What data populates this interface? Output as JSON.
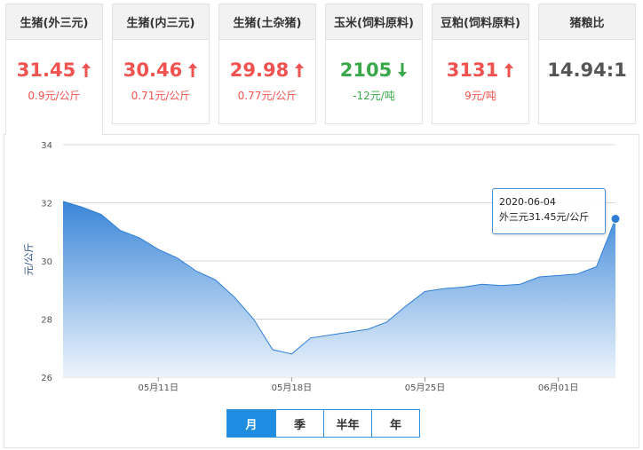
{
  "cards": [
    {
      "title": "生猪(外三元)",
      "price": "31.45",
      "change": "0.9元/公斤",
      "trend": "up"
    },
    {
      "title": "生猪(内三元)",
      "price": "30.46",
      "change": "0.71元/公斤",
      "trend": "up"
    },
    {
      "title": "生猪(土杂猪)",
      "price": "29.98",
      "change": "0.77元/公斤",
      "trend": "up"
    },
    {
      "title": "玉米(饲料原料)",
      "price": "2105",
      "change": "-12元/吨",
      "trend": "down"
    },
    {
      "title": "豆粕(饲料原料)",
      "price": "3131",
      "change": "9元/吨",
      "trend": "up"
    },
    {
      "title": "猪粮比",
      "price": "14.94:1",
      "change": "",
      "trend": "flat"
    }
  ],
  "colors": {
    "up": "#f0524f",
    "down": "#3aa84a",
    "accent": "#1e8ce0",
    "area_top": "#2f7fd6",
    "area_bottom": "#eaf3fc"
  },
  "icons": {
    "up": "arrow-up-icon",
    "down": "arrow-down-icon"
  },
  "chart_data": {
    "type": "area",
    "ylabel": "元/公斤",
    "ylim": [
      26,
      34
    ],
    "yticks": [
      26,
      28,
      30,
      32,
      34
    ],
    "xtick_labels": [
      "05月11日",
      "05月18日",
      "05月25日",
      "06月01日"
    ],
    "xtick_dates": [
      "2020-05-11",
      "2020-05-18",
      "2020-05-25",
      "2020-06-01"
    ],
    "grid": true,
    "series": [
      {
        "x": [
          "2020-05-06",
          "2020-05-07",
          "2020-05-08",
          "2020-05-09",
          "2020-05-10",
          "2020-05-11",
          "2020-05-12",
          "2020-05-13",
          "2020-05-14",
          "2020-05-15",
          "2020-05-16",
          "2020-05-17",
          "2020-05-18",
          "2020-05-19",
          "2020-05-20",
          "2020-05-21",
          "2020-05-22",
          "2020-05-23",
          "2020-05-24",
          "2020-05-25",
          "2020-05-26",
          "2020-05-27",
          "2020-05-28",
          "2020-05-29",
          "2020-05-30",
          "2020-05-31",
          "2020-06-01",
          "2020-06-02",
          "2020-06-03",
          "2020-06-04"
        ],
        "values": [
          32.05,
          31.85,
          31.6,
          31.05,
          30.8,
          30.4,
          30.1,
          29.65,
          29.35,
          28.75,
          28.0,
          26.95,
          26.8,
          27.35,
          27.45,
          27.55,
          27.65,
          27.9,
          28.45,
          28.95,
          29.05,
          29.1,
          29.2,
          29.15,
          29.2,
          29.45,
          29.5,
          29.55,
          29.8,
          31.45
        ]
      }
    ],
    "tooltip": {
      "date": "2020-06-04",
      "label": "外三元31.45元/公斤"
    }
  },
  "period_tabs": [
    {
      "label": "月",
      "selected": true
    },
    {
      "label": "季",
      "selected": false
    },
    {
      "label": "半年",
      "selected": false
    },
    {
      "label": "年",
      "selected": false
    }
  ]
}
